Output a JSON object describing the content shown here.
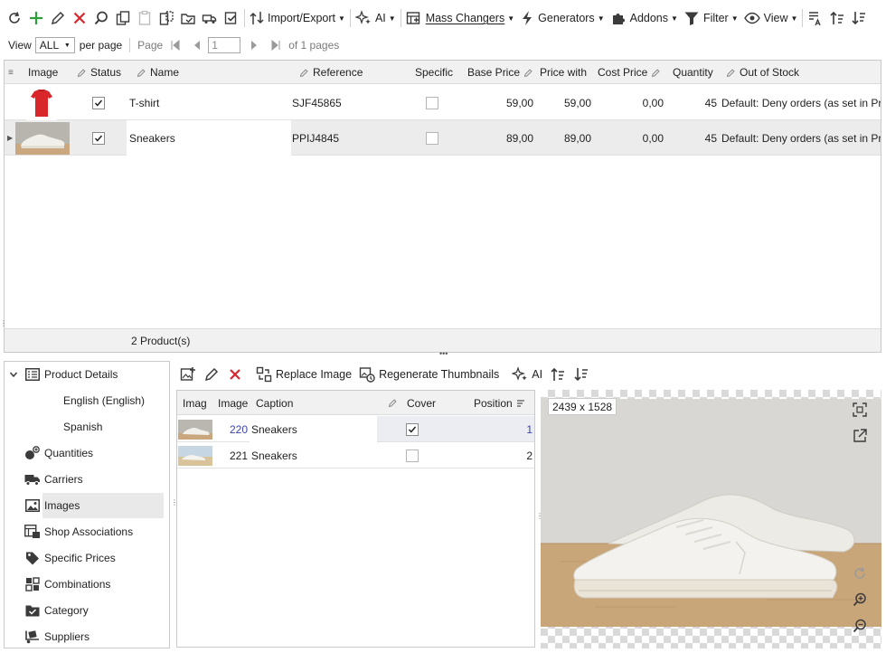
{
  "toolbar": {
    "import_export_label": "Import/Export",
    "ai_label": "AI",
    "mass_changers_label": "Mass Changers",
    "generators_label": "Generators",
    "addons_label": "Addons",
    "filter_label": "Filter",
    "view_label": "View"
  },
  "pager": {
    "view_label": "View",
    "view_value": "ALL",
    "per_page_label": "per page",
    "page_label": "Page",
    "page_value": "1",
    "of_pages_label": "of 1 pages"
  },
  "grid": {
    "columns": [
      "Image",
      "Status",
      "Name",
      "Reference",
      "Specific",
      "Base Price",
      "Price with",
      "Cost Price",
      "Quantity",
      "Out of Stock"
    ],
    "rows": [
      {
        "name": "T-shirt",
        "reference": "SJF45865",
        "status": true,
        "specific": false,
        "base_price": "59,00",
        "price_with": "59,00",
        "cost_price": "0,00",
        "quantity": "45",
        "out_of_stock": "Default: Deny orders (as set in Pref"
      },
      {
        "name": "Sneakers",
        "reference": "PPIJ4845",
        "status": true,
        "specific": false,
        "base_price": "89,00",
        "price_with": "89,00",
        "cost_price": "0,00",
        "quantity": "45",
        "out_of_stock": "Default: Deny orders (as set in Pref"
      }
    ],
    "footer": "2 Product(s)"
  },
  "nav": {
    "items": [
      {
        "label": "Product Details",
        "icon": "details-icon"
      },
      {
        "label": "English (English)"
      },
      {
        "label": "Spanish"
      },
      {
        "label": "Quantities",
        "icon": "quantities-icon"
      },
      {
        "label": "Carriers",
        "icon": "truck-icon"
      },
      {
        "label": "Images",
        "icon": "image-icon"
      },
      {
        "label": "Shop Associations",
        "icon": "shop-icon"
      },
      {
        "label": "Specific Prices",
        "icon": "tag-icon"
      },
      {
        "label": "Combinations",
        "icon": "grid-icon"
      },
      {
        "label": "Category",
        "icon": "folder-icon"
      },
      {
        "label": "Suppliers",
        "icon": "supplier-icon"
      }
    ]
  },
  "images_panel": {
    "toolbar": {
      "replace_label": "Replace Image",
      "regenerate_label": "Regenerate Thumbnails",
      "ai_label": "AI"
    },
    "columns": [
      "Imag",
      "Image",
      "Caption",
      "Cover",
      "Position"
    ],
    "rows": [
      {
        "id": "220",
        "caption": "Sneakers",
        "cover": true,
        "position": "1"
      },
      {
        "id": "221",
        "caption": "Sneakers",
        "cover": false,
        "position": "2"
      }
    ]
  },
  "preview": {
    "dimensions": "2439 x 1528"
  },
  "colors": {
    "green": "#2e9e3b",
    "red": "#d9272e",
    "blue_link": "#3a44b0",
    "icon_dark": "#3b3b3b"
  }
}
